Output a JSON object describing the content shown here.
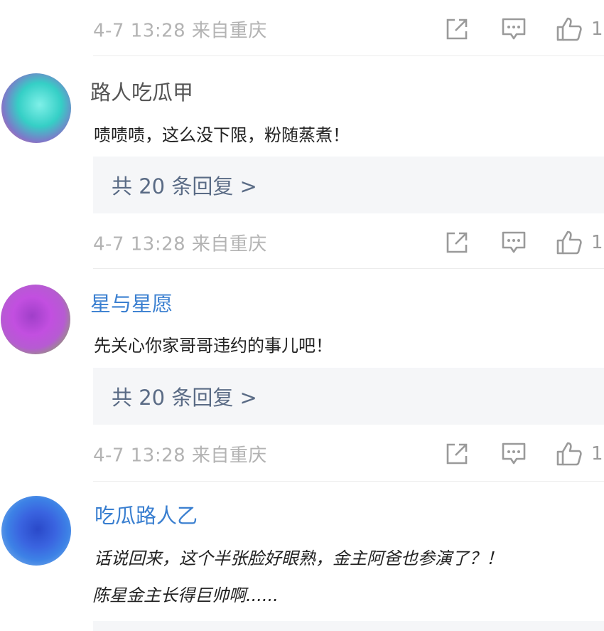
{
  "meta_rows": [
    {
      "datetime_location": "4-7 13:28 来自重庆",
      "like_count_partial": "1"
    },
    {
      "datetime_location": "4-7 13:28 来自重庆",
      "like_count_partial": "1"
    },
    {
      "datetime_location": "4-7 13:28 来自重庆",
      "like_count_partial": "1"
    }
  ],
  "comments": [
    {
      "username": "路人吃瓜甲",
      "username_color": "#555555",
      "text": "啧啧啧，这么没下限，粉随蒸煮！",
      "reply_label": "共 20 条回复 >"
    },
    {
      "username": "星与星愿",
      "username_color": "#3a7fd0",
      "text": "先关心你家哥哥违约的事儿吧！",
      "reply_label": "共 20 条回复 >"
    },
    {
      "username": "吃瓜路人乙",
      "username_color": "#3a7fd0",
      "text_line1": "话说回来，这个半张脸好眼熟，金主阿爸也参演了？！",
      "text_line2": "陈星金主长得巨帅啊......"
    }
  ],
  "icons": [
    "share-icon",
    "comment-icon",
    "thumbs-up-icon"
  ]
}
